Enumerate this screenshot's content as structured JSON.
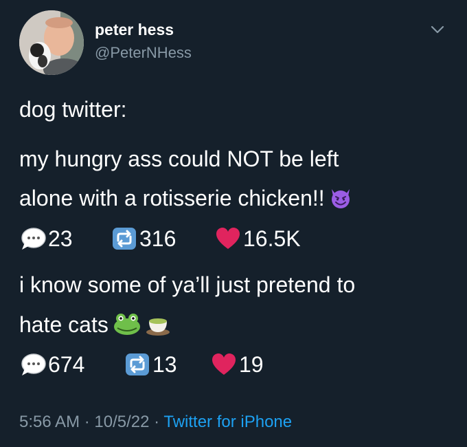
{
  "header": {
    "name": "peter hess",
    "handle": "@PeterNHess"
  },
  "icons": {
    "menu": "chevron-down-icon",
    "reply": "speech-bubble-icon",
    "retweet": "retweet-icon",
    "like": "red-heart-icon"
  },
  "tweet": {
    "line1": "dog twitter:",
    "line2": "my hungry ass could NOT be left",
    "line3": "alone with a rotisserie chicken!!",
    "line3_emoji": "smiling-devil-emoji",
    "stats": {
      "replies": "23",
      "retweets": "316",
      "likes": "16.5K"
    },
    "line4": "i know some of ya’ll just pretend to",
    "line5": "hate cats",
    "line5_emojis": [
      "frog-emoji",
      "tea-emoji"
    ],
    "stats2": {
      "replies": "674",
      "retweets": "13",
      "likes": "19"
    }
  },
  "footer": {
    "time": "5:56 AM",
    "sep1": " · ",
    "date": "10/5/22",
    "sep2": " · ",
    "source": "Twitter for iPhone"
  },
  "colors": {
    "background": "#15202b",
    "text": "#ffffff",
    "muted": "#8899a6",
    "link": "#1da1f2",
    "heart": "#e0245e"
  }
}
